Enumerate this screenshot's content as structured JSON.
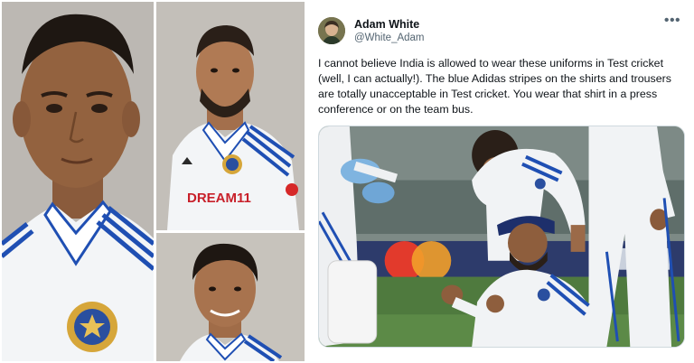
{
  "collage": {
    "photos": [
      {
        "subject": "player-portrait-left"
      },
      {
        "subject": "player-portrait-top-right"
      },
      {
        "subject": "player-portrait-bottom-right"
      }
    ],
    "jersey_sponsor": "DREAM11",
    "colors": {
      "jersey": "#f4f6f8",
      "stripe": "#1f4fb3",
      "background": "#bdb9b4"
    }
  },
  "tweet": {
    "display_name": "Adam White",
    "handle": "@White_Adam",
    "more_icon": "more-horizontal-icon",
    "text": "I cannot believe India is allowed to wear these uniforms in Test cricket (well, I can actually!). The blue Adidas stripes on the shirts and trousers are totally unacceptable in Test cricket. You wear that shirt in a press conference or on the team bus.",
    "media_subject": "players-on-field-attending-to-batter"
  }
}
